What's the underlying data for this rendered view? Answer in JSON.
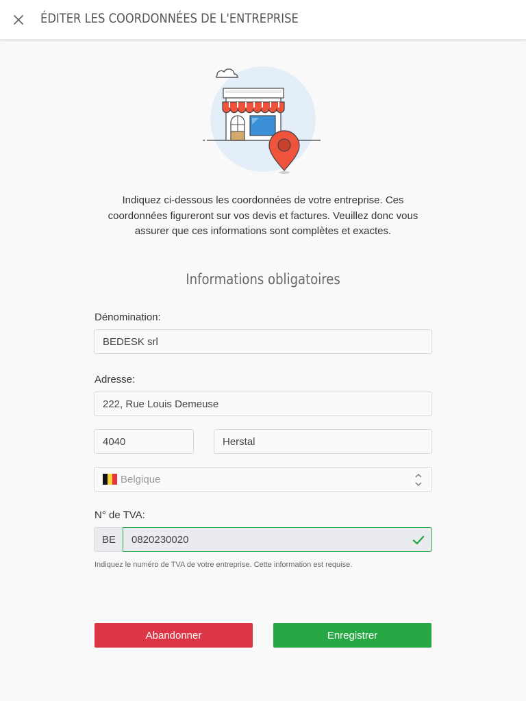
{
  "header": {
    "title": "ÉDITER LES COORDONNÉES DE L'ENTREPRISE",
    "close_icon": "close-icon"
  },
  "intro": {
    "line1": "Indiquez ci-dessous les coordonnées de votre entreprise. Ces",
    "line2": "coordonnées figureront sur vos devis et factures. Veuillez donc vous",
    "line3": "assurer que ces informations sont complètes et exactes."
  },
  "section_title": "Informations obligatoires",
  "form": {
    "denomination_label": "Dénomination:",
    "denomination_value": "BEDESK srl",
    "address_label": "Adresse:",
    "street_value": "222, Rue Louis Demeuse",
    "postcode_value": "4040",
    "city_value": "Herstal",
    "country_value": "Belgique",
    "country_flag": "belgium-flag-icon",
    "vat_label": "N° de TVA:",
    "vat_prefix": "BE",
    "vat_value": "0820230020",
    "vat_help": "Indiquez le numéro de TVA de votre entreprise. Cette information est requise."
  },
  "buttons": {
    "cancel_label": "Abandonner",
    "save_label": "Enregistrer"
  },
  "colors": {
    "danger": "#dc3545",
    "success": "#28a745",
    "awning": "#f0533c",
    "pin": "#f0533c"
  }
}
